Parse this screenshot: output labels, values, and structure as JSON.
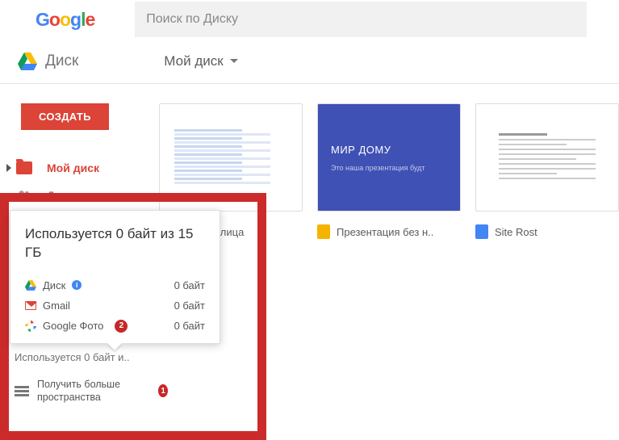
{
  "header": {
    "search_placeholder": "Поиск по Диску"
  },
  "toolbar": {
    "app_name": "Диск",
    "breadcrumb": "Мой диск"
  },
  "sidebar": {
    "create_label": "СОЗДАТЬ",
    "items": [
      {
        "label": "Мой диск",
        "active": true
      },
      {
        "label": "Доступные мне",
        "active": false
      }
    ]
  },
  "files": [
    {
      "name": "овая таблица",
      "kind": "sheet"
    },
    {
      "name": "Презентация без н..",
      "kind": "slides",
      "slide_title": "МИР ДОМУ",
      "slide_sub": "Это наша презентация будт"
    },
    {
      "name": "Site Rost",
      "kind": "doc"
    }
  ],
  "storage_popup": {
    "title": "Используется 0 байт из 15 ГБ",
    "rows": [
      {
        "label": "Диск",
        "value": "0 байт",
        "info": true
      },
      {
        "label": "Gmail",
        "value": "0 байт"
      },
      {
        "label": "Google Фото",
        "value": "0 байт",
        "badge": "2"
      }
    ]
  },
  "bottom": {
    "usage_text": "Используется 0 байт и..",
    "more_label": "Получить больше пространства",
    "badge": "1"
  }
}
